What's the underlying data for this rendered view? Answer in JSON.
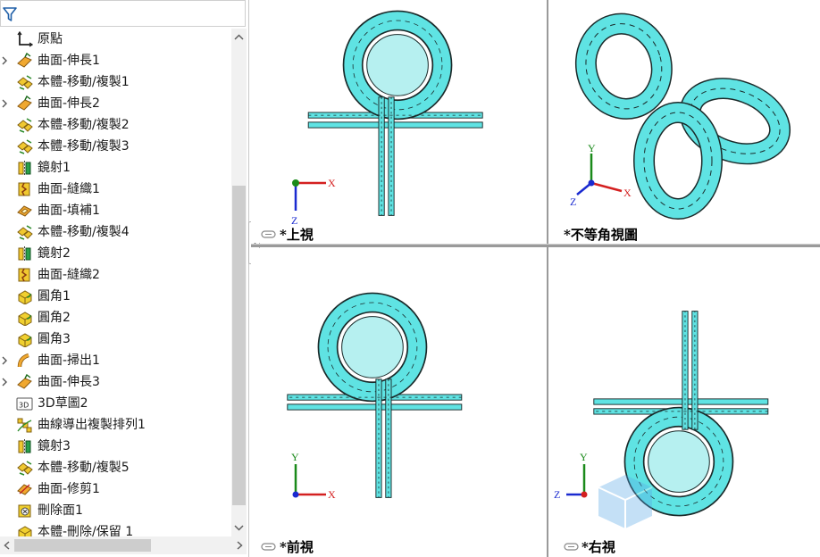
{
  "tree": {
    "items": [
      {
        "label": "原點",
        "icon": "origin-icon",
        "expandable": false
      },
      {
        "label": "曲面-伸長1",
        "icon": "extrude-surface-icon",
        "expandable": true
      },
      {
        "label": "本體-移動/複製1",
        "icon": "move-copy-body-icon",
        "expandable": false
      },
      {
        "label": "曲面-伸長2",
        "icon": "extrude-surface-icon",
        "expandable": true
      },
      {
        "label": "本體-移動/複製2",
        "icon": "move-copy-body-icon",
        "expandable": false
      },
      {
        "label": "本體-移動/複製3",
        "icon": "move-copy-body-icon",
        "expandable": false
      },
      {
        "label": "鏡射1",
        "icon": "mirror-icon",
        "expandable": false
      },
      {
        "label": "曲面-縫織1",
        "icon": "knit-surface-icon",
        "expandable": false
      },
      {
        "label": "曲面-填補1",
        "icon": "fill-surface-icon",
        "expandable": false
      },
      {
        "label": "本體-移動/複製4",
        "icon": "move-copy-body-icon",
        "expandable": false
      },
      {
        "label": "鏡射2",
        "icon": "mirror-icon",
        "expandable": false
      },
      {
        "label": "曲面-縫織2",
        "icon": "knit-surface-icon",
        "expandable": false
      },
      {
        "label": "圓角1",
        "icon": "fillet-icon",
        "expandable": false
      },
      {
        "label": "圓角2",
        "icon": "fillet-icon",
        "expandable": false
      },
      {
        "label": "圓角3",
        "icon": "fillet-icon",
        "expandable": false
      },
      {
        "label": "曲面-掃出1",
        "icon": "sweep-surface-icon",
        "expandable": true
      },
      {
        "label": "曲面-伸長3",
        "icon": "extrude-surface-icon",
        "expandable": true
      },
      {
        "label": "3D草圖2",
        "icon": "sketch-3d-icon",
        "expandable": false
      },
      {
        "label": "曲線導出複製排列1",
        "icon": "curve-pattern-icon",
        "expandable": false
      },
      {
        "label": "鏡射3",
        "icon": "mirror-icon",
        "expandable": false
      },
      {
        "label": "本體-移動/複製5",
        "icon": "move-copy-body-icon",
        "expandable": false
      },
      {
        "label": "曲面-修剪1",
        "icon": "trim-surface-icon",
        "expandable": false
      },
      {
        "label": "刪除面1",
        "icon": "delete-face-icon",
        "expandable": false
      },
      {
        "label": "本體-刪除/保留 1",
        "icon": "delete-body-icon",
        "expandable": false
      }
    ]
  },
  "viewports": {
    "top": {
      "label": "*上視",
      "axis_h": "X",
      "axis_v": "Z"
    },
    "iso": {
      "label": "*不等角視圖",
      "axis_x": "X",
      "axis_y": "Y",
      "axis_z": "Z"
    },
    "front": {
      "label": "*前視",
      "axis_h": "X",
      "axis_v": "Y"
    },
    "right": {
      "label": "*右視",
      "axis_h": "Z",
      "axis_v": "Y"
    }
  },
  "colors": {
    "model_fill": "#5fe3e3",
    "model_edge": "#1a2a2a",
    "axis_x": "#d42020",
    "axis_y": "#1a8a1a",
    "axis_z": "#1a2ad0"
  }
}
